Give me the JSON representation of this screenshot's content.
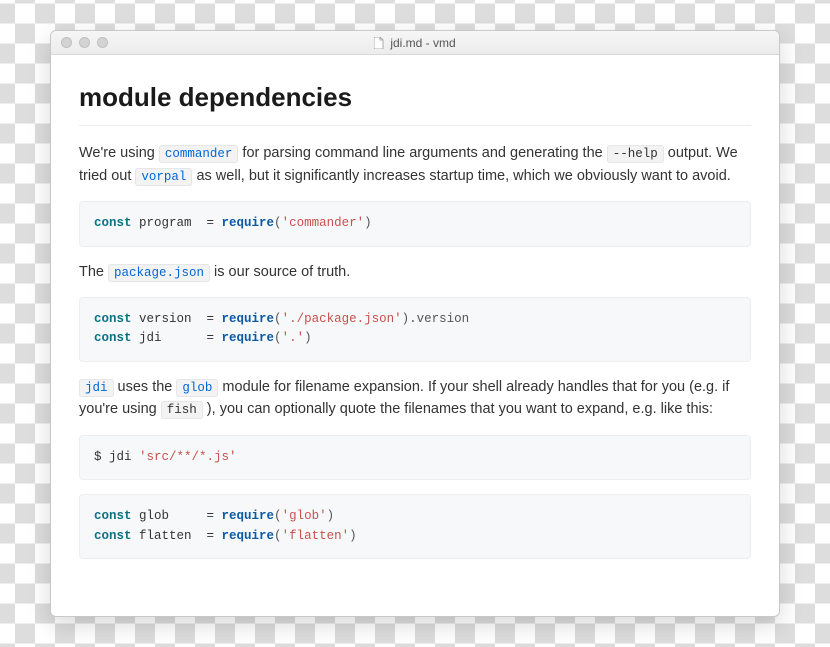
{
  "window": {
    "title": "jdi.md - vmd"
  },
  "doc": {
    "heading": "module dependencies",
    "para1": {
      "t1": "We're using ",
      "code1": "commander",
      "t2": " for parsing command line arguments and generating the ",
      "code2": "--help",
      "t3": " output. We tried out ",
      "code3": "vorpal",
      "t4": " as well, but it significantly increases startup time, which we obviously want to avoid."
    },
    "code1": {
      "kw1": "const",
      "var1": " program  = ",
      "fn1": "require",
      "p1": "(",
      "str1": "'commander'",
      "p2": ")"
    },
    "para2": {
      "t1": "The ",
      "code1": "package.json",
      "t2": " is our source of truth."
    },
    "code2": {
      "kw1": "const",
      "var1": " version  = ",
      "fn1": "require",
      "p1": "(",
      "str1": "'./package.json'",
      "p2": ").version",
      "nl": "\n",
      "kw2": "const",
      "var2": " jdi      = ",
      "fn2": "require",
      "p3": "(",
      "str2": "'.'",
      "p4": ")"
    },
    "para3": {
      "code1": "jdi",
      "t1": " uses the ",
      "code2": "glob",
      "t2": " module for filename expansion. If your shell already handles that for you (e.g. if you're using ",
      "code3": "fish",
      "t3": " ), you can optionally quote the filenames that you want to expand, e.g. like this:"
    },
    "code3": {
      "t1": "$ jdi ",
      "str1": "'src/**/*.js'"
    },
    "code4": {
      "kw1": "const",
      "var1": " glob     = ",
      "fn1": "require",
      "p1": "(",
      "str1": "'glob'",
      "p2": ")",
      "nl": "\n",
      "kw2": "const",
      "var2": " flatten  = ",
      "fn2": "require",
      "p3": "(",
      "str2": "'flatten'",
      "p4": ")"
    }
  }
}
